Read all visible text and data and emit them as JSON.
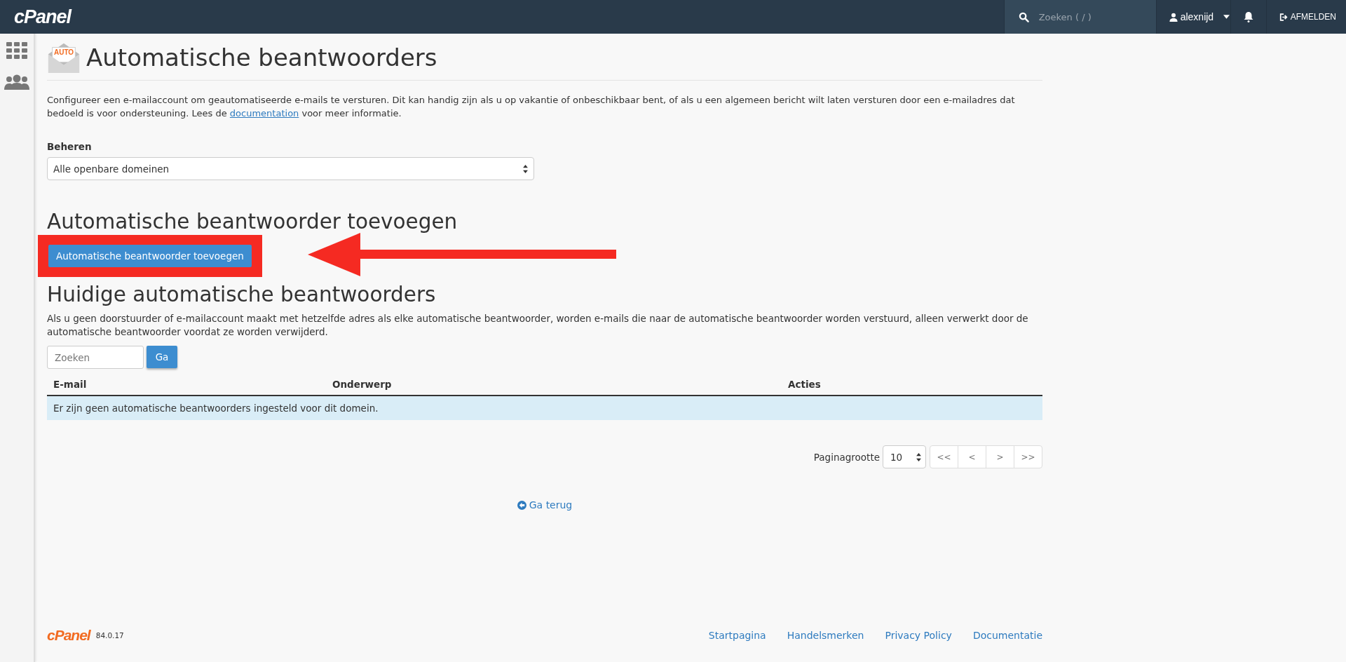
{
  "top_bar": {
    "logo": "cPanel",
    "search": {
      "placeholder": "Zoeken ( / )"
    },
    "user": "alexnijd",
    "logout": "AFMELDEN"
  },
  "page": {
    "badge": "AUTO",
    "title": "Automatische beantwoorders",
    "intro": {
      "before": "Configureer een e-mailaccount om geautomatiseerde e-mails te versturen. Dit kan handig zijn als u op vakantie of onbeschikbaar bent, of als u een algemeen bericht wilt laten versturen door een e-mailadres dat bedoeld is voor ondersteuning. Lees de ",
      "link": "documentation",
      "after": " voor meer informatie."
    },
    "manage": {
      "label": "Beheren",
      "value": "Alle openbare domeinen"
    },
    "add_section": {
      "heading": "Automatische beantwoorder toevoegen",
      "button": "Automatische beantwoorder toevoegen"
    },
    "current_section": {
      "heading": "Huidige automatische beantwoorders",
      "description": "Als u geen doorstuurder of e-mailaccount maakt met hetzelfde adres als elke automatische beantwoorder, worden e-mails die naar de automatische beantwoorder worden verstuurd, alleen verwerkt door de automatische beantwoorder voordat ze worden verwijderd.",
      "search": {
        "placeholder": "Zoeken",
        "button": "Ga"
      },
      "table": {
        "columns": [
          "E-mail",
          "Onderwerp",
          "Acties"
        ],
        "empty_message": "Er zijn geen automatische beantwoorders ingesteld voor dit domein."
      },
      "pagination": {
        "label": "Paginagrootte",
        "page_size": "10",
        "buttons": [
          "<<",
          "<",
          ">",
          ">>"
        ]
      }
    },
    "back_link": "Ga terug"
  },
  "footer": {
    "logo": "cPanel",
    "version": "84.0.17",
    "links": [
      "Startpagina",
      "Handelsmerken",
      "Privacy Policy",
      "Documentatie"
    ]
  }
}
